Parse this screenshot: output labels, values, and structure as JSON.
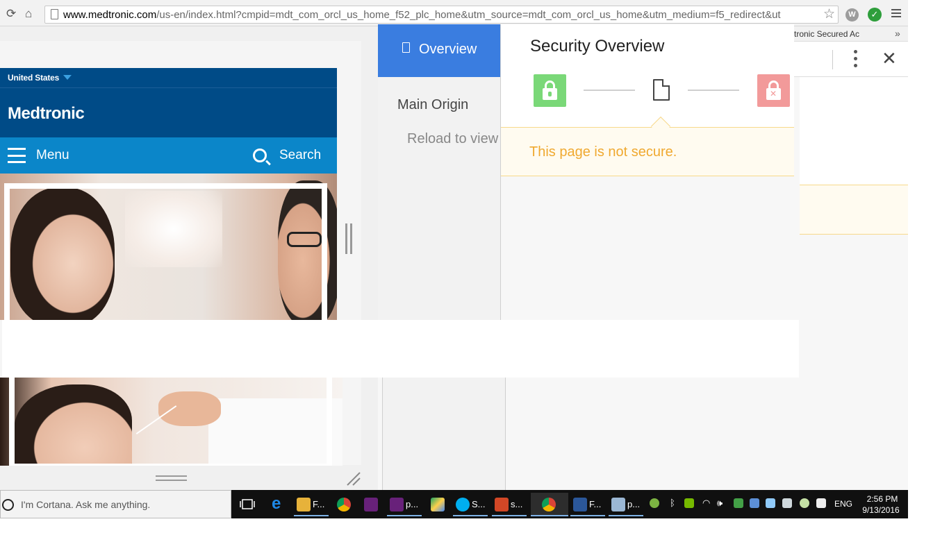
{
  "browser": {
    "url_host": "www.medtronic.com",
    "url_path": "/us-en/index.html?cmpid=mdt_com_orcl_us_home_f52_plc_home&utm_source=mdt_com_orcl_us_home&utm_medium=f5_redirect&ut",
    "extension_w_label": "W"
  },
  "medtronic": {
    "country": "United States",
    "logo": "Medtronic",
    "menu_label": "Menu",
    "search_label": "Search"
  },
  "devtools": {
    "tab_label": "tronic Secured Ac",
    "more_tabs": "»",
    "close_glyph": "✕"
  },
  "security": {
    "sidebar_tab": "Overview",
    "main_origin": "Main Origin",
    "reload_text": "Reload to view",
    "title": "Security Overview",
    "status_message": "This page is not secure."
  },
  "taskbar": {
    "cortana_placeholder": "I'm Cortana. Ask me anything.",
    "apps": [
      {
        "name": "file-explorer",
        "label": "F...",
        "color": "#e7b23a"
      },
      {
        "name": "chrome",
        "label": "",
        "color": "#db4437"
      },
      {
        "name": "visual-studio",
        "label": "",
        "color": "#68217a"
      },
      {
        "name": "visual-studio-2",
        "label": "p...",
        "color": "#68217a"
      },
      {
        "name": "google-drive",
        "label": "",
        "color": "#1fa463"
      },
      {
        "name": "skype",
        "label": "S...",
        "color": "#00aff0"
      },
      {
        "name": "powerpoint",
        "label": "s...",
        "color": "#d24726"
      },
      {
        "name": "chrome-active",
        "label": "",
        "color": "#db4437"
      },
      {
        "name": "word",
        "label": "F...",
        "color": "#2b579a"
      },
      {
        "name": "notepad",
        "label": "p...",
        "color": "#9bb7d4"
      }
    ],
    "language": "ENG",
    "time": "2:56 PM",
    "date": "9/13/2016"
  }
}
